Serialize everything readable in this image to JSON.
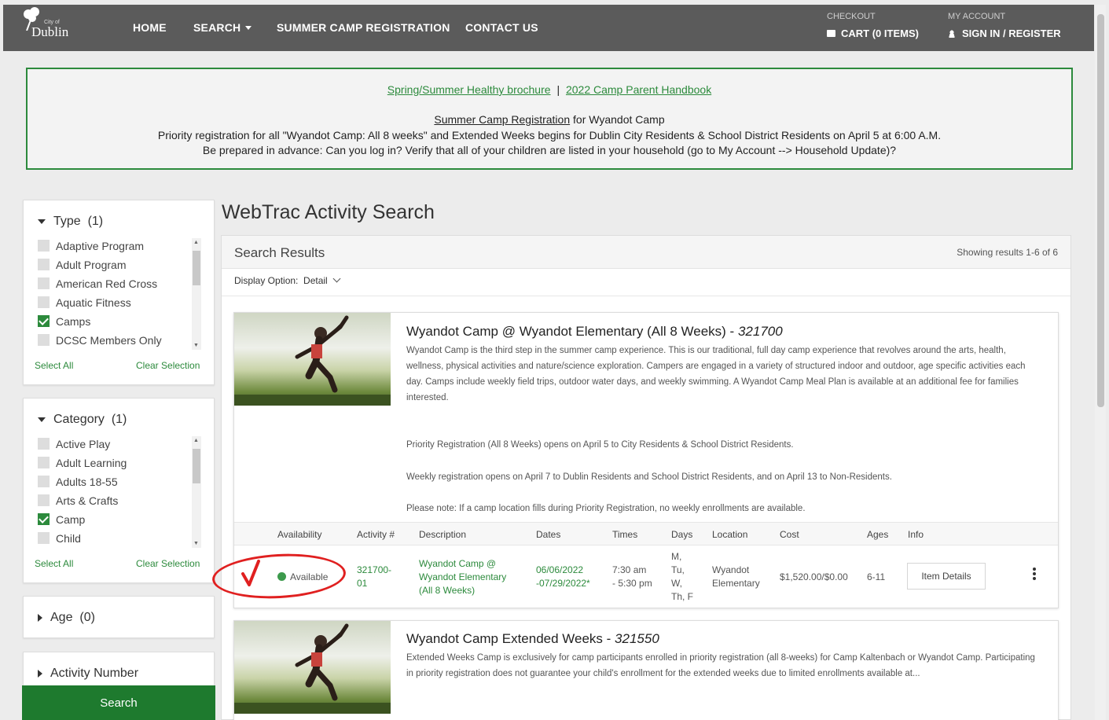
{
  "header": {
    "logo_top": "City of",
    "logo_name": "Dublin",
    "nav": [
      "HOME",
      "SEARCH",
      "SUMMER CAMP REGISTRATION",
      "CONTACT US"
    ],
    "checkout_label": "CHECKOUT",
    "cart_label": "CART (0 ITEMS)",
    "account_label": "MY ACCOUNT",
    "signin_label": "SIGN IN / REGISTER"
  },
  "banner": {
    "link1": "Spring/Summer Healthy brochure",
    "sep": "|",
    "link2": "2022 Camp Parent Handbook",
    "reg_link": "Summer Camp Registration",
    "reg_suffix": " for Wyandot Camp",
    "line3": "Priority registration for all \"Wyandot Camp: All 8 weeks\" and Extended Weeks begins for Dublin City Residents & School District Residents on April 5 at 6:00 A.M.",
    "line4": "Be prepared in advance: Can you log in? Verify that all of your children are listed in your household (go to My Account --> Household Update)?"
  },
  "sidebar": {
    "type": {
      "title": "Type",
      "count": "(1)",
      "items": [
        {
          "label": "Adaptive Program",
          "checked": false
        },
        {
          "label": "Adult Program",
          "checked": false
        },
        {
          "label": "American Red Cross",
          "checked": false
        },
        {
          "label": "Aquatic Fitness",
          "checked": false
        },
        {
          "label": "Camps",
          "checked": true
        },
        {
          "label": "DCSC Members Only",
          "checked": false
        }
      ],
      "select_all": "Select All",
      "clear": "Clear Selection"
    },
    "category": {
      "title": "Category",
      "count": "(1)",
      "items": [
        {
          "label": "Active Play",
          "checked": false
        },
        {
          "label": "Adult Learning",
          "checked": false
        },
        {
          "label": "Adults 18-55",
          "checked": false
        },
        {
          "label": "Arts & Crafts",
          "checked": false
        },
        {
          "label": "Camp",
          "checked": true
        },
        {
          "label": "Child",
          "checked": false
        }
      ],
      "select_all": "Select All",
      "clear": "Clear Selection"
    },
    "age": {
      "title": "Age",
      "count": "(0)"
    },
    "activity_number": {
      "title": "Activity Number"
    },
    "search_button": "Search"
  },
  "main": {
    "page_title": "WebTrac Activity Search",
    "results_title": "Search Results",
    "results_count": "Showing results 1-6 of 6",
    "display_option_label": "Display Option:",
    "display_option_value": "Detail",
    "columns": [
      "Availability",
      "Activity #",
      "Description",
      "Dates",
      "Times",
      "Days",
      "Location",
      "Cost",
      "Ages",
      "Info"
    ],
    "cards": [
      {
        "title": "Wyandot Camp @ Wyandot Elementary (All 8 Weeks) - ",
        "number": "321700",
        "desc1": "Wyandot Camp is the third step in the summer camp experience. This is our traditional, full day camp experience that revolves around the arts, health, wellness, physical activities and nature/science exploration. Campers are engaged in a variety of structured indoor and outdoor, age specific activities each day. Camps include weekly field trips, outdoor water days, and weekly swimming. A Wyandot Camp Meal Plan is available at an additional fee for families interested.",
        "desc2": "Priority Registration (All 8 Weeks) opens on April 5 to City Residents & School District Residents.",
        "desc3": "Weekly registration opens on April 7 to Dublin Residents and School District Residents, and on April 13 to Non-Residents.",
        "desc4": "Please note: If a camp location fills during Priority Registration, no weekly enrollments are available.",
        "row": {
          "availability": "Available",
          "activity_line1": "321700-",
          "activity_line2": "01",
          "desc_line1": "Wyandot Camp @",
          "desc_line2": "Wyandot Elementary",
          "desc_line3": "(All 8 Weeks)",
          "dates_line1": "06/06/2022",
          "dates_line2": "-07/29/2022*",
          "times_line1": "7:30 am",
          "times_line2": "- 5:30 pm",
          "days_line1": "M,",
          "days_line2": "Tu,",
          "days_line3": "W,",
          "days_line4": "Th, F",
          "location_line1": "Wyandot",
          "location_line2": "Elementary",
          "cost": "$1,520.00/$0.00",
          "ages": "6-11",
          "info_button": "Item Details"
        }
      },
      {
        "title": "Wyandot Camp Extended Weeks - ",
        "number": "321550",
        "desc1": "Extended Weeks Camp is exclusively for camp participants enrolled in priority registration (all 8-weeks) for Camp Kaltenbach or Wyandot Camp. Participating in priority registration does not guarantee your child's enrollment for the extended weeks due to limited enrollments available at..."
      }
    ]
  },
  "colors": {
    "nav_bg": "#5b5b5b",
    "accent_green": "#2c8a3c",
    "search_button": "#1e7a2e",
    "annotation_red": "#e02020"
  }
}
